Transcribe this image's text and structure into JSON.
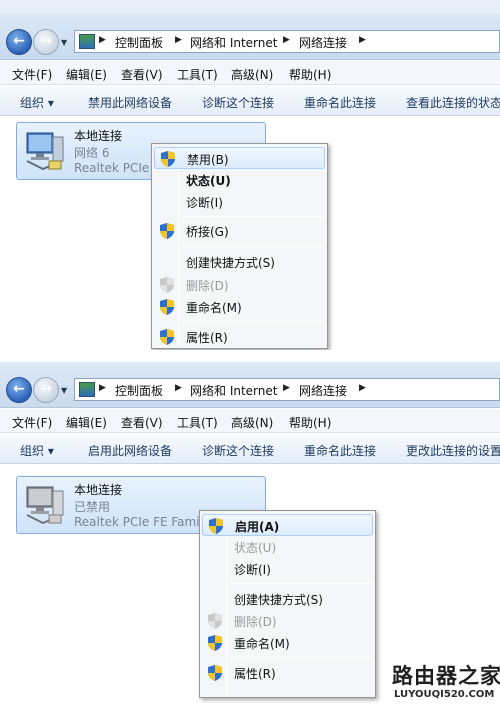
{
  "colors": {
    "accent": "#2b62b8",
    "tile_bg": "#cfe3fa",
    "menu_bg": "#f5f6f8"
  },
  "breadcrumb": [
    "控制面板",
    "网络和 Internet",
    "网络连接"
  ],
  "menubar": [
    "文件(F)",
    "编辑(E)",
    "查看(V)",
    "工具(T)",
    "高级(N)",
    "帮助(H)"
  ],
  "top": {
    "toolbar": [
      "组织 ▾",
      "禁用此网络设备",
      "诊断这个连接",
      "重命名此连接",
      "查看此连接的状态"
    ],
    "connection": {
      "name": "本地连接",
      "status": "网络  6",
      "adapter": "Realtek PCIe"
    },
    "context_menu": [
      {
        "label": "禁用(B)",
        "icon": "shield-icon",
        "bold": false,
        "disabled": false,
        "highlighted": true
      },
      {
        "label": "状态(U)",
        "icon": "",
        "bold": true,
        "disabled": false,
        "highlighted": false
      },
      {
        "label": "诊断(I)",
        "icon": "",
        "bold": false,
        "disabled": false,
        "highlighted": false
      },
      {
        "label": "桥接(G)",
        "icon": "shield-icon",
        "bold": false,
        "disabled": false,
        "highlighted": false
      },
      {
        "label": "创建快捷方式(S)",
        "icon": "",
        "bold": false,
        "disabled": false,
        "highlighted": false
      },
      {
        "label": "删除(D)",
        "icon": "shield-icon",
        "bold": false,
        "disabled": true,
        "highlighted": false
      },
      {
        "label": "重命名(M)",
        "icon": "shield-icon",
        "bold": false,
        "disabled": false,
        "highlighted": false
      },
      {
        "label": "属性(R)",
        "icon": "shield-icon",
        "bold": false,
        "disabled": false,
        "highlighted": false
      }
    ]
  },
  "bottom": {
    "toolbar": [
      "组织 ▾",
      "启用此网络设备",
      "诊断这个连接",
      "重命名此连接",
      "更改此连接的设置"
    ],
    "connection": {
      "name": "本地连接",
      "status": "已禁用",
      "adapter": "Realtek PCIe FE Family"
    },
    "context_menu": [
      {
        "label": "启用(A)",
        "icon": "shield-icon",
        "bold": true,
        "disabled": false,
        "highlighted": true
      },
      {
        "label": "状态(U)",
        "icon": "",
        "bold": false,
        "disabled": true,
        "highlighted": false
      },
      {
        "label": "诊断(I)",
        "icon": "",
        "bold": false,
        "disabled": false,
        "highlighted": false
      },
      {
        "label": "创建快捷方式(S)",
        "icon": "",
        "bold": false,
        "disabled": false,
        "highlighted": false
      },
      {
        "label": "删除(D)",
        "icon": "shield-icon",
        "bold": false,
        "disabled": true,
        "highlighted": false
      },
      {
        "label": "重命名(M)",
        "icon": "shield-icon",
        "bold": false,
        "disabled": false,
        "highlighted": false
      },
      {
        "label": "属性(R)",
        "icon": "shield-icon",
        "bold": false,
        "disabled": false,
        "highlighted": false
      }
    ]
  },
  "watermark": {
    "title": "路由器之家",
    "url": "LUYOUQI520.COM"
  }
}
